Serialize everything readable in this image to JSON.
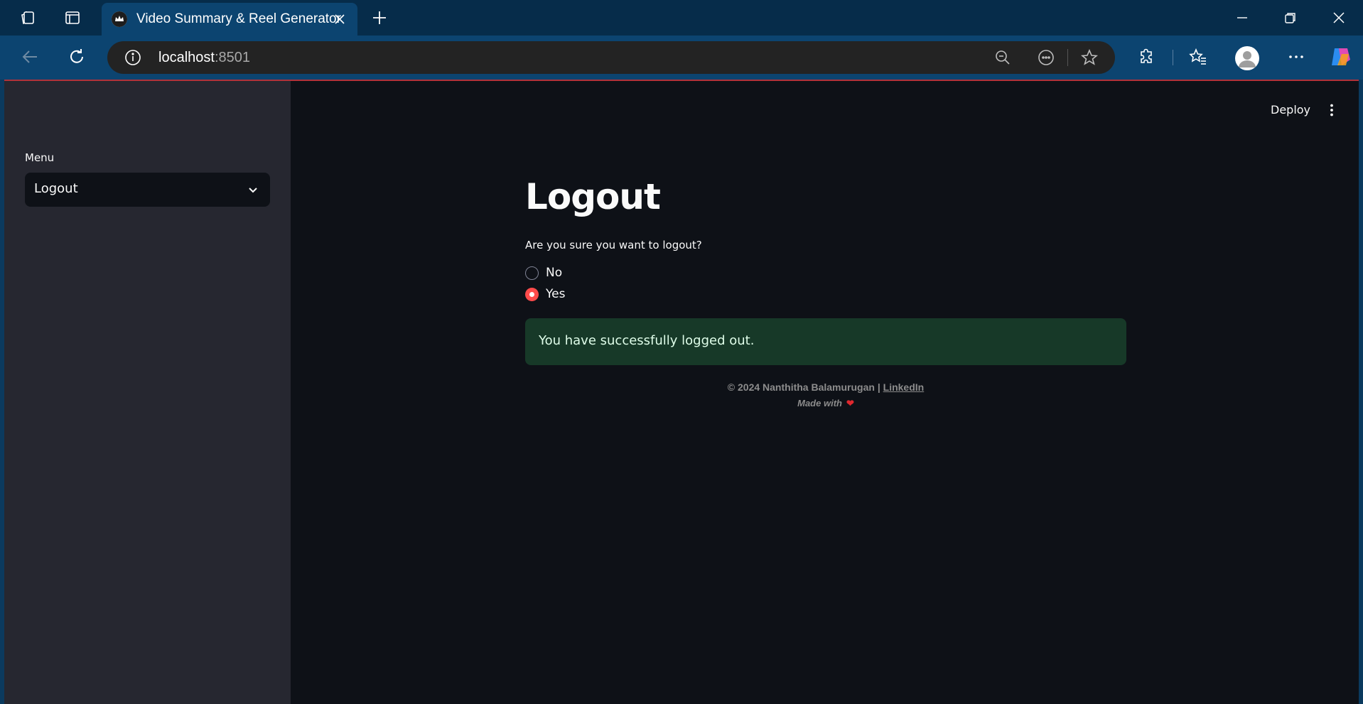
{
  "browser": {
    "tab_title": "Video Summary & Reel Generator",
    "url_host": "localhost",
    "url_port": ":8501"
  },
  "app": {
    "deploy_label": "Deploy",
    "sidebar": {
      "menu_label": "Menu",
      "selected": "Logout"
    },
    "main": {
      "title": "Logout",
      "question": "Are you sure you want to logout?",
      "options": [
        {
          "label": "No",
          "selected": false
        },
        {
          "label": "Yes",
          "selected": true
        }
      ],
      "success_message": "You have successfully logged out."
    },
    "footer": {
      "copyright": "© 2024 Nanthitha Balamurugan |",
      "link_label": "LinkedIn",
      "made_with": "Made with",
      "heart": "❤"
    }
  },
  "colors": {
    "accent": "#ff4b4b",
    "success_bg": "#173928",
    "sidebar_bg": "#262730",
    "main_bg": "#0e1117"
  },
  "icons": [
    "workspaces-icon",
    "tab-actions-icon",
    "app-favicon-icon",
    "close-icon",
    "new-tab-icon",
    "minimize-icon",
    "restore-icon",
    "window-close-icon",
    "back-icon",
    "refresh-icon",
    "info-icon",
    "zoom-out-icon",
    "reader-icon",
    "star-icon",
    "extensions-icon",
    "favorites-icon",
    "profile-icon",
    "more-icon",
    "copilot-icon",
    "chevron-down-icon",
    "kebab-icon",
    "heart-icon"
  ]
}
